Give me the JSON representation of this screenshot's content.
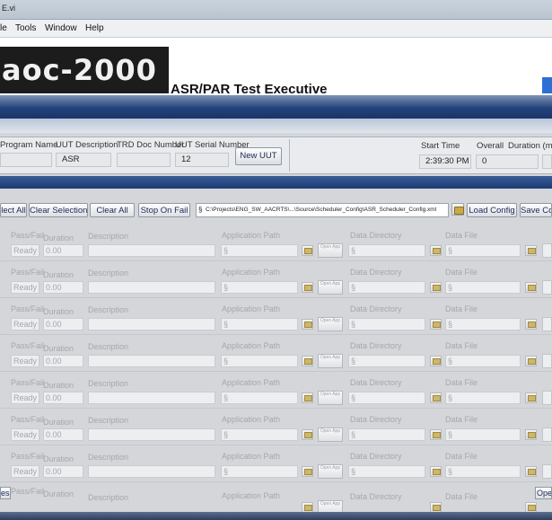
{
  "window": {
    "title": "E.vi"
  },
  "menu": {
    "items": [
      "le",
      "Tools",
      "Window",
      "Help"
    ]
  },
  "banner": {
    "logo_text": "aoc-2000",
    "app_title": "ASR/PAR Test Executive"
  },
  "info": {
    "program_name_label": "Program Name",
    "uut_description_label": "UUT Description",
    "uut_description_value": "ASR",
    "trd_doc_label": "TRD Doc Number",
    "uut_serial_label": "UUT Serial Number",
    "uut_serial_value": "12",
    "new_uut_button": "New UUT",
    "start_time_label": "Start Time",
    "start_time_value": "2:39:30 PM",
    "overall_label": "Overall",
    "overall_value": "0",
    "duration_label": "Duration (m"
  },
  "toolbar": {
    "select_all": "lect All",
    "clear_selection": "Clear Selection",
    "clear_all": "Clear All",
    "stop_on_fail": "Stop On Fail",
    "config_path_prefix": "§",
    "config_path": "C:\\Projects\\ENG_SW_AACRTS\\...\\Source\\Scheduler_Config\\ASR_Scheduler_Config.xml",
    "load_config": "Load Config",
    "save_config": "Save Co"
  },
  "row_labels": {
    "pass_fail": "Pass/Fail",
    "duration": "Duration",
    "description": "Description",
    "application_path": "Application Path",
    "data_directory": "Data Directory",
    "data_file": "Data File",
    "open_app": "Open App",
    "path_prefix": "§"
  },
  "rows": [
    {
      "status": "Ready",
      "duration": "0.00"
    },
    {
      "status": "Ready",
      "duration": "0.00"
    },
    {
      "status": "Ready",
      "duration": "0.00"
    },
    {
      "status": "Ready",
      "duration": "0.00"
    },
    {
      "status": "Ready",
      "duration": "0.00"
    },
    {
      "status": "Ready",
      "duration": "0.00"
    },
    {
      "status": "Ready",
      "duration": "0.00"
    },
    {
      "status": "",
      "duration": ""
    }
  ],
  "bottom": {
    "left_button": "ess",
    "right_button": "Ope"
  }
}
